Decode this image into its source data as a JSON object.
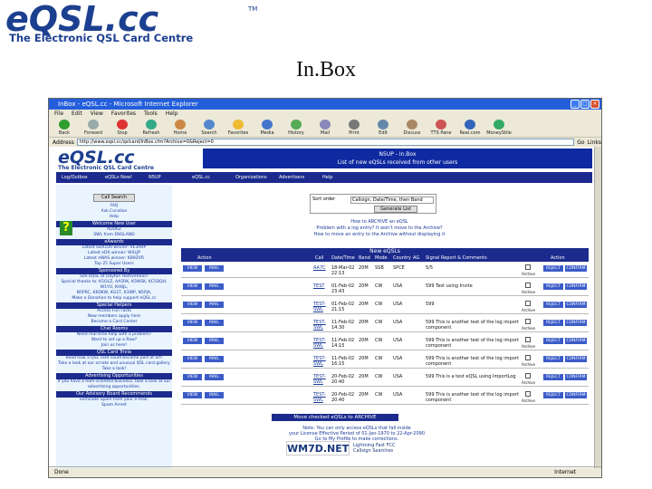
{
  "logo": {
    "brand": "eQSL.cc",
    "tm": "TM",
    "tagline": "The Electronic QSL Card Centre"
  },
  "slide": {
    "title": "In.Box"
  },
  "window": {
    "title": "InBox - eQSL.cc - Microsoft Internet Explorer"
  },
  "menu": [
    "File",
    "Edit",
    "View",
    "Favorites",
    "Tools",
    "Help"
  ],
  "toolbar": [
    "Back",
    "Forward",
    "Stop",
    "Refresh",
    "Home",
    "Search",
    "Favorites",
    "Media",
    "History",
    "Mail",
    "Print",
    "Edit",
    "Discuss",
    "TTS Pane",
    "Real.com",
    "MoneyStile"
  ],
  "address": {
    "label": "Address",
    "url": "http://www.eqsl.cc/qslcard/InBox.cfm?Archive=0&Reject=0",
    "go": "Go",
    "links": "Links"
  },
  "page_header": {
    "line1": "N5UP - In.Box",
    "line2": "List of new eQSLs received from other users"
  },
  "nav": [
    "Log/Outbox",
    "eQSLs Now!",
    "N5UP",
    "eQSL.cc",
    "Organizations",
    "Advertisers",
    "Help"
  ],
  "sidebar": {
    "callsign_button": "Call Search",
    "links": [
      "FAQ",
      "Ask.Curation",
      "Help"
    ],
    "sections": [
      {
        "title": "Welcome New User",
        "rows": [
          "ADD6Z",
          "SWL from ENGLAND"
        ]
      },
      {
        "title": "eAwards",
        "rows": [
          "Latest eDX100 winner: VE3ARP",
          "Latest eDX winner: W4LJP",
          "Latest eWAS winner: KB9ZVR",
          "Top 25 Super Users"
        ]
      },
      {
        "title": "Sponsored By",
        "rows": [
          "See eQSL at Dayton Hamvention!",
          "Special thanks to: K5OLZ, AA5RK, K5WSK, KC5DQH, W1YU, KH6JL,",
          "N5PRC, K6DKW, KG1T, K3WP, N5PJA,",
          "Make a Donation to help support eQSL.cc"
        ]
      },
      {
        "title": "Special Helpers",
        "rows": [
          "Access Fun Facts",
          "New members apply here",
          "Become a Card Center"
        ]
      },
      {
        "title": "Chat Rooms",
        "rows": [
          "Need real-time help with a problem?",
          "Want to set up a Raw?",
          "Join us here!"
        ]
      },
      {
        "title": "QSL Card Trivia",
        "rows": [
          "Read how a QSL card could become part of art!",
          "Take a look at our ornate and unusual QSL card gallery",
          "Take a look!"
        ]
      },
      {
        "title": "Advertising Opportunities",
        "rows": [
          "If you have a ham-oriented business, take a look at our advertising opportunities."
        ]
      },
      {
        "title": "Our Advisory Board Recommends",
        "rows": [
          "Eliminate Spam from your e-mail:",
          "Spam Arrest"
        ]
      }
    ]
  },
  "sort": {
    "label": "Sort order",
    "value": "Callsign, Date/Time, then Band",
    "button": "Generate List"
  },
  "help_links": [
    "How to ARCHIVE an eQSL",
    "Problem with a log entry? It won't move to the Archive?",
    "How to move an entry to the Archive without displaying it"
  ],
  "table": {
    "title": "New eQSLs",
    "headers": [
      "Action",
      "Call",
      "Date/Time",
      "Band",
      "Mode",
      "Country",
      "AG",
      "Signal Report & Comments",
      "Action"
    ],
    "rows": [
      {
        "call": "AA7C",
        "date": "18-Mar-02 22:13",
        "band": "20M",
        "mode": "SSB",
        "country": "SPCE",
        "comment": "5/5"
      },
      {
        "call": "TEST",
        "date": "01-Feb-02 23:43",
        "band": "20M",
        "mode": "CW",
        "country": "USA",
        "comment": "599 Test using Invite"
      },
      {
        "call": "TEST-SWL",
        "date": "01-Feb-02 21:15",
        "band": "20M",
        "mode": "CW",
        "country": "USA",
        "comment": "599"
      },
      {
        "call": "TEST-SWL",
        "date": "11-Feb-02 14:30",
        "band": "20M",
        "mode": "CW",
        "country": "USA",
        "comment": "599 This is another test of the log import component"
      },
      {
        "call": "TEST-SWL",
        "date": "11-Feb-02 14:15",
        "band": "20M",
        "mode": "CW",
        "country": "USA",
        "comment": "599 This is another test of the log import component"
      },
      {
        "call": "TEST-SWL",
        "date": "11-Feb-02 16:15",
        "band": "20M",
        "mode": "CW",
        "country": "USA",
        "comment": "599 This is another test of the log import component"
      },
      {
        "call": "TEST-SWL",
        "date": "20-Feb-02 20:40",
        "band": "20M",
        "mode": "CW",
        "country": "USA",
        "comment": "599 This is a test eQSL using ImportLog"
      },
      {
        "call": "TEST-SWL",
        "date": "20-Feb-02 20:40",
        "band": "20M",
        "mode": "CW",
        "country": "USA",
        "comment": "599 This is another test of the log import component"
      }
    ],
    "btn_view": "VIEW",
    "btn_mail": "MAIL",
    "btn_reject": "REJECT",
    "btn_confirm": "CONFIRM",
    "archive_label": "Archive"
  },
  "move_button": "Move checked eQSLs to ARCHIVE",
  "notice": [
    "Note: You can only access eQSLs that fall inside",
    "your License Effective Period of 01-Jan-1970 to 22-Apr-2090",
    "Go to My Profile to make corrections."
  ],
  "banner": {
    "brand": "WM7D.NET",
    "tag1": "Lightning Fast  FCC",
    "tag2": "Callsign  Searches"
  },
  "status": {
    "left": "Done",
    "right": "Internet"
  }
}
